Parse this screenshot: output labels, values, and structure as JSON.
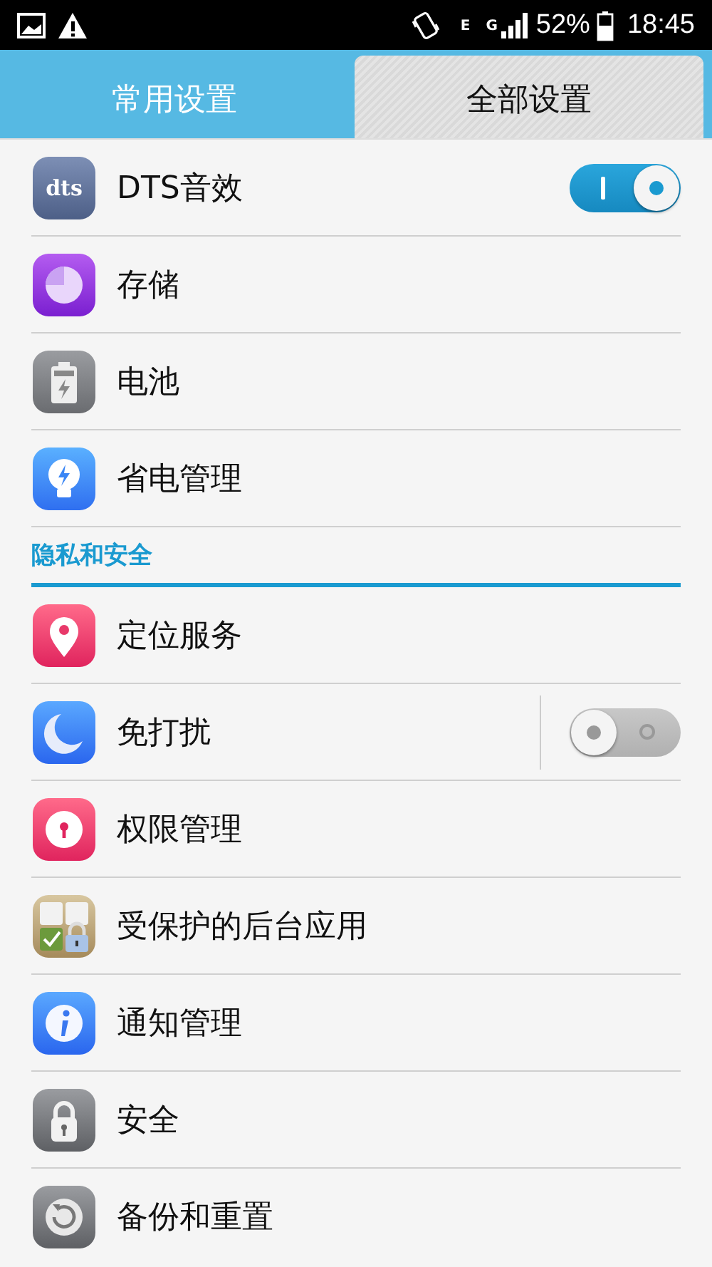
{
  "status_bar": {
    "network_e": "E",
    "network_g": "G",
    "battery": "52%",
    "time": "18:45"
  },
  "tabs": [
    {
      "label": "常用设置",
      "selected": false
    },
    {
      "label": "全部设置",
      "selected": true
    }
  ],
  "sections": [
    {
      "items": [
        {
          "label": "DTS音效",
          "logo_text": "dts",
          "kind": "toggle",
          "on": true
        },
        {
          "label": "存储",
          "kind": "link"
        },
        {
          "label": "电池",
          "kind": "link"
        },
        {
          "label": "省电管理",
          "kind": "link"
        }
      ]
    },
    {
      "title": "隐私和安全",
      "items": [
        {
          "label": "定位服务",
          "kind": "link"
        },
        {
          "label": "免打扰",
          "kind": "toggle",
          "on": false
        },
        {
          "label": "权限管理",
          "kind": "link"
        },
        {
          "label": "受保护的后台应用",
          "kind": "link"
        },
        {
          "label": "通知管理",
          "kind": "link"
        },
        {
          "label": "安全",
          "kind": "link"
        },
        {
          "label": "备份和重置",
          "kind": "link"
        }
      ]
    }
  ]
}
